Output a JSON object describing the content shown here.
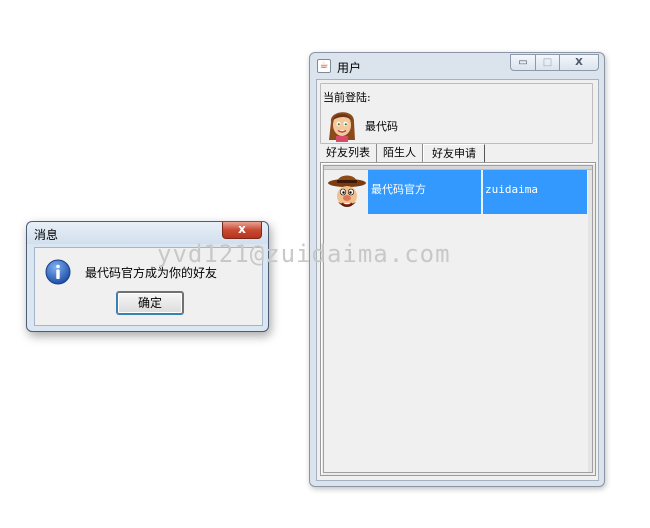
{
  "message_dialog": {
    "title": "消息",
    "close_symbol": "x",
    "icon": "info-icon",
    "message": "最代码官方成为你的好友",
    "ok_label": "确定"
  },
  "watermark": "yvd121@zuidaima.com",
  "user_window": {
    "title": "用户",
    "app_icon": "java-icon",
    "buttons": {
      "minimize": "▭",
      "maximize": "□",
      "close": "X"
    },
    "login_label": "当前登陆:",
    "current_user": {
      "avatar": "girl-avatar-icon",
      "name": "最代码"
    },
    "tabs": [
      {
        "label": "好友列表"
      },
      {
        "label": "陌生人"
      },
      {
        "label": "好友申请",
        "selected": true
      }
    ],
    "friend_requests": [
      {
        "avatar": "cowboy-avatar-icon",
        "name": "最代码官方",
        "id": "zuidaima",
        "selected": true
      }
    ],
    "selection_color": "#3399ff"
  }
}
